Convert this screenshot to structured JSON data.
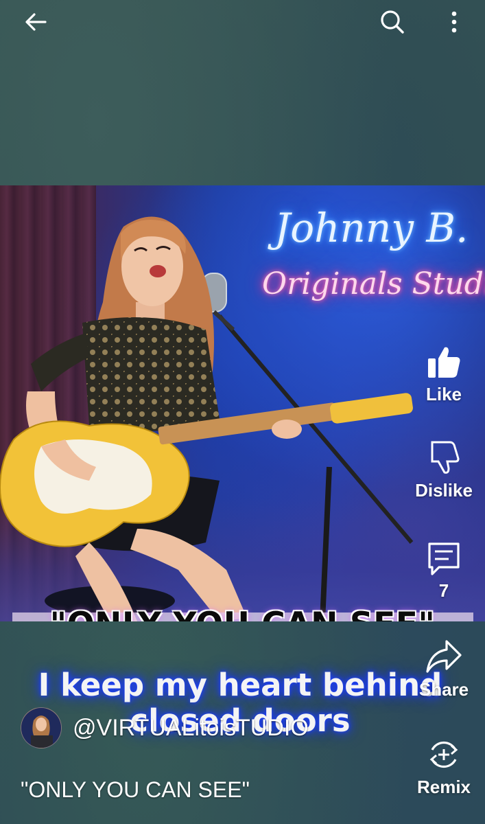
{
  "topbar": {
    "back_icon": "arrow-left-icon",
    "search_icon": "search-icon",
    "more_icon": "more-vertical-icon"
  },
  "video": {
    "neon_line1": "Johnny B.",
    "neon_line2": "Originals Studio",
    "caption": "\"ONLY YOU CAN SEE\""
  },
  "actions": {
    "like_label": "Like",
    "dislike_label": "Dislike",
    "comments_count": "7",
    "share_label": "Share",
    "remix_label": "Remix"
  },
  "lyrics": {
    "line1": "I keep my heart behind",
    "line2": "closed doors"
  },
  "channel": {
    "handle": "@VIRTUALitoisTUDIO"
  },
  "video_title": "\"ONLY YOU CAN SEE\""
}
